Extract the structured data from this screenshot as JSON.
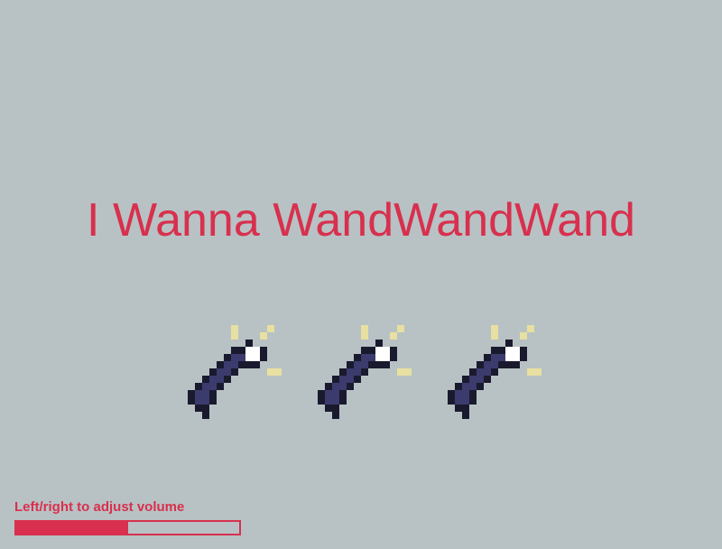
{
  "game": {
    "title": "I Wanna WandWandWand"
  },
  "volume": {
    "label": "Left/right to adjust volume",
    "level": 0.5
  },
  "wands": [
    {
      "icon": "wand-icon"
    },
    {
      "icon": "wand-icon"
    },
    {
      "icon": "wand-icon"
    }
  ],
  "colors": {
    "background": "#b8c2c4",
    "accent": "#d8304e",
    "wand_body": "#3b3b6e",
    "wand_outline": "#1a1a2e",
    "sparkle": "#e8e0a0"
  }
}
